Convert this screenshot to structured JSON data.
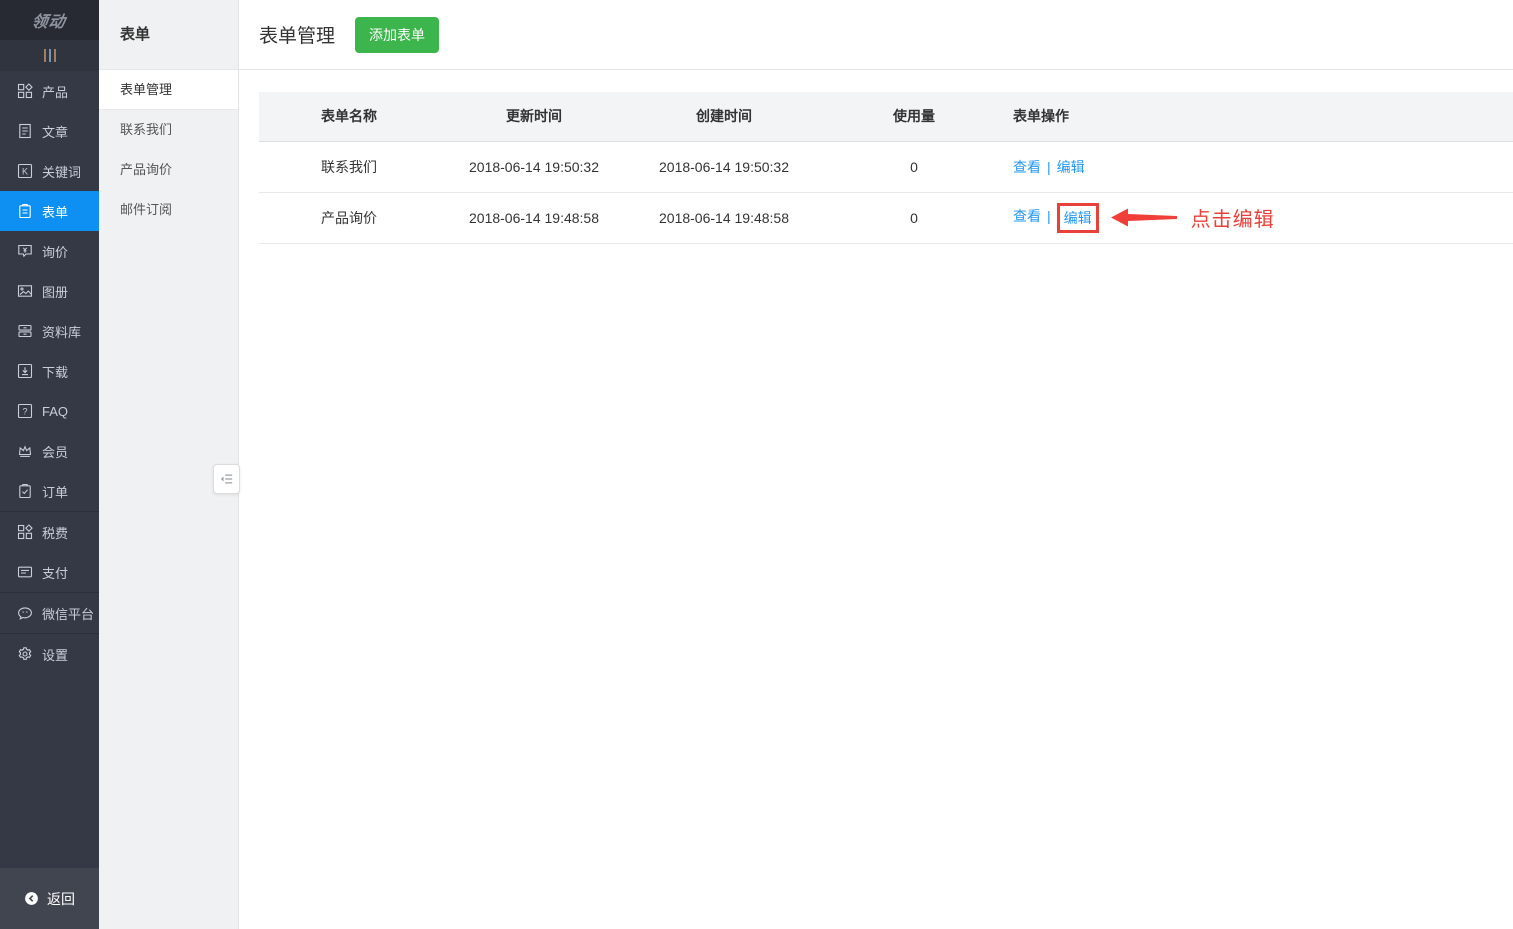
{
  "brand": {
    "logo_text": "领动"
  },
  "colors": {
    "sidebar_bg": "#353945",
    "active_blue": "#0e90f2",
    "link_blue": "#2598f5",
    "button_green": "#3cb64c",
    "annotation_red": "#e8403a"
  },
  "sidebar": {
    "groups": [
      {
        "items": [
          {
            "icon": "grid-icon",
            "label": "产品"
          },
          {
            "icon": "article-icon",
            "label": "文章"
          },
          {
            "icon": "keyword-icon",
            "label": "关键词"
          },
          {
            "icon": "form-icon",
            "label": "表单"
          },
          {
            "icon": "inquiry-icon",
            "label": "询价"
          },
          {
            "icon": "gallery-icon",
            "label": "图册"
          },
          {
            "icon": "library-icon",
            "label": "资料库"
          },
          {
            "icon": "download-icon",
            "label": "下载"
          },
          {
            "icon": "faq-icon",
            "label": "FAQ"
          },
          {
            "icon": "member-icon",
            "label": "会员"
          },
          {
            "icon": "order-icon",
            "label": "订单"
          }
        ]
      },
      {
        "items": [
          {
            "icon": "grid-icon",
            "label": "税费"
          },
          {
            "icon": "card-icon",
            "label": "支付"
          }
        ]
      },
      {
        "items": [
          {
            "icon": "wechat-icon",
            "label": "微信平台"
          }
        ]
      },
      {
        "items": [
          {
            "icon": "gear-icon",
            "label": "设置"
          }
        ]
      }
    ],
    "back_label": "返回"
  },
  "submenu": {
    "title": "表单",
    "items": [
      {
        "label": "表单管理"
      },
      {
        "label": "联系我们"
      },
      {
        "label": "产品询价"
      },
      {
        "label": "邮件订阅"
      }
    ]
  },
  "header": {
    "title": "表单管理",
    "add_button_label": "添加表单"
  },
  "table": {
    "columns": [
      "表单名称",
      "更新时间",
      "创建时间",
      "使用量",
      "表单操作"
    ],
    "action_view": "查看",
    "action_edit": "编辑",
    "action_separator": "|",
    "rows": [
      {
        "name": "联系我们",
        "updated": "2018-06-14 19:50:32",
        "created": "2018-06-14 19:50:32",
        "usage": "0"
      },
      {
        "name": "产品询价",
        "updated": "2018-06-14 19:48:58",
        "created": "2018-06-14 19:48:58",
        "usage": "0"
      }
    ]
  },
  "annotation": {
    "label": "点击编辑"
  }
}
